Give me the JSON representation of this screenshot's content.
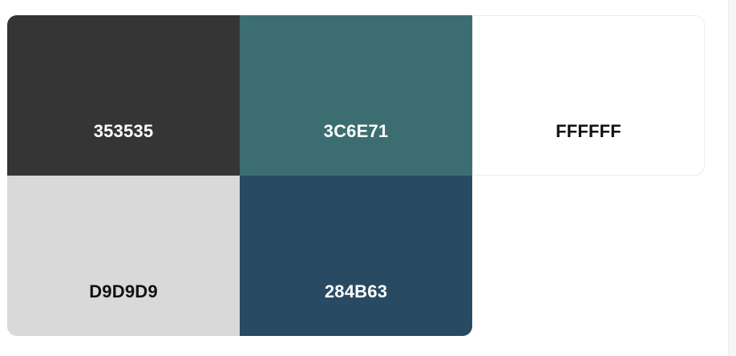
{
  "palette": {
    "swatches": [
      {
        "hex": "353535",
        "color": "#353535",
        "text_tone": "light-on-dark"
      },
      {
        "hex": "3C6E71",
        "color": "#3C6E71",
        "text_tone": "light-on-dark"
      },
      {
        "hex": "FFFFFF",
        "color": "#FFFFFF",
        "text_tone": "dark-on-light"
      },
      {
        "hex": "D9D9D9",
        "color": "#D9D9D9",
        "text_tone": "dark-on-light"
      },
      {
        "hex": "284B63",
        "color": "#284B63",
        "text_tone": "light-on-dark"
      }
    ]
  }
}
